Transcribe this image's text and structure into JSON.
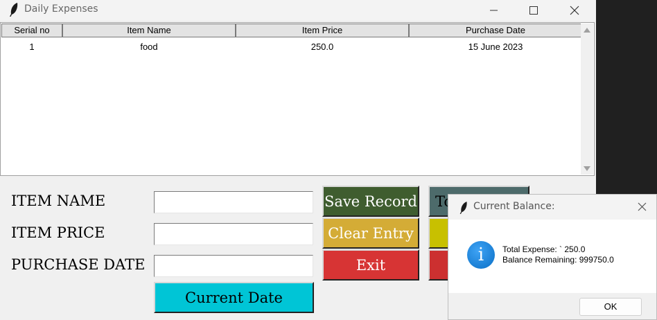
{
  "window": {
    "title": "Daily Expenses",
    "minimize_icon": "minimize-icon",
    "maximize_icon": "maximize-icon",
    "close_icon": "close-icon"
  },
  "table": {
    "columns": [
      "Serial no",
      "Item Name",
      "Item Price",
      "Purchase Date"
    ],
    "rows": [
      {
        "serial": "1",
        "name": "food",
        "price": "250.0",
        "date": "15 June 2023"
      }
    ]
  },
  "form": {
    "item_name_label": "ITEM NAME",
    "item_price_label": "ITEM PRICE",
    "purchase_date_label": "PURCHASE DATE",
    "item_name_value": "",
    "item_price_value": "",
    "purchase_date_value": ""
  },
  "buttons": {
    "current_date": "Current Date",
    "save_record": "Save Record",
    "clear_entry": "Clear Entry",
    "exit": "Exit",
    "total_partial": "To"
  },
  "colors": {
    "save": "#3f5d2f",
    "clear": "#d4ac36",
    "exit": "#d73434",
    "current_date": "#00c5d6",
    "total": "#4d6b6b",
    "yellow_btn": "#c8c000",
    "red_btn": "#cc3030"
  },
  "dialog": {
    "title": "Current Balance:",
    "line1": "Total Expense: ` 250.0",
    "line2": "Balance Remaining: 999750.0",
    "ok": "OK",
    "icon": "info-icon"
  }
}
